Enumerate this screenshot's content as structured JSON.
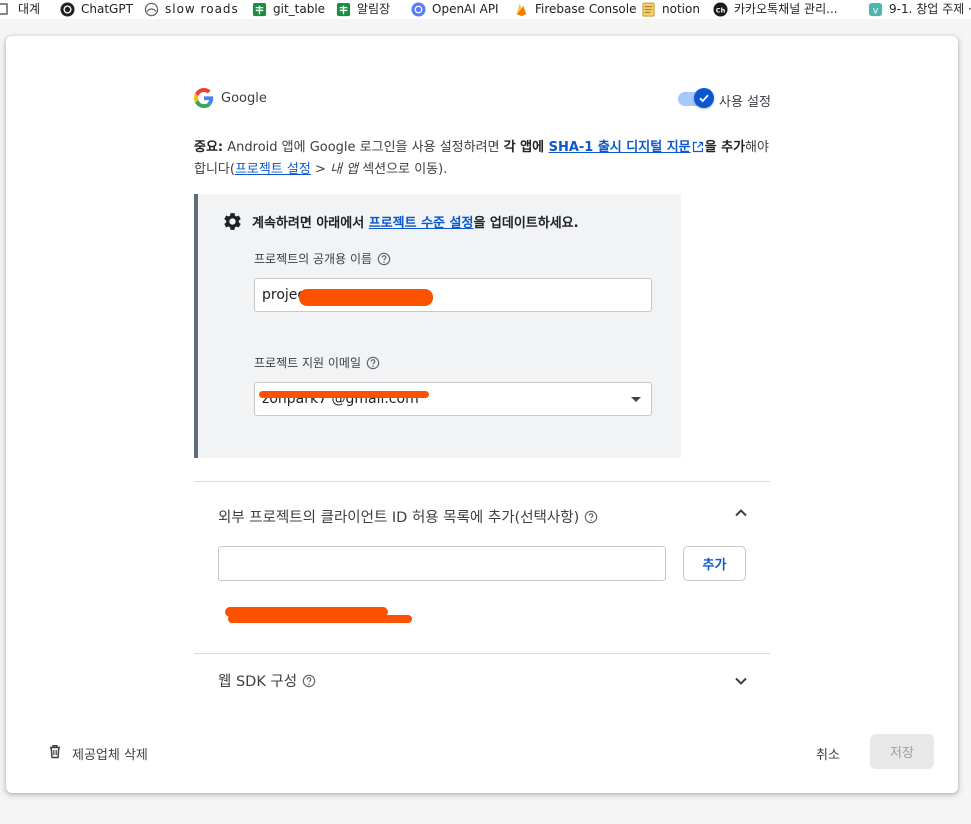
{
  "bookmarks": [
    {
      "label": "대계",
      "icon": "folder-icon"
    },
    {
      "label": "ChatGPT",
      "icon": "chatgpt-icon"
    },
    {
      "label": "slow roads",
      "icon": "slow-roads-icon"
    },
    {
      "label": "git_table",
      "icon": "sheets-icon"
    },
    {
      "label": "알림장",
      "icon": "sheets-icon"
    },
    {
      "label": "OpenAI API",
      "icon": "openai-icon"
    },
    {
      "label": "Firebase Console",
      "icon": "firebase-icon"
    },
    {
      "label": "notion",
      "icon": "notion-icon"
    },
    {
      "label": "카카오톡채널 관리...",
      "icon": "kakao-channel-icon"
    },
    {
      "label": "9-1. 창업 주제 ·",
      "icon": "v-app-icon"
    }
  ],
  "provider": {
    "name": "Google",
    "toggle_label": "사용 설정",
    "enabled": true
  },
  "notice": {
    "prefix": "중요:",
    "text1": " Android 앱에 Google 로그인을 사용 설정하려면 ",
    "bold1": "각 앱에 ",
    "link_sha": "SHA-1 출시 디지털 지문",
    "bold2": "을 추가",
    "text2": "해야 합니다(",
    "link_settings": "프로젝트 설정",
    "text3": " > ",
    "italic_myapps": "내 앱",
    "text4": " 섹션으로 이동)."
  },
  "setup": {
    "title_prefix": "계속하려면 아래에서 ",
    "title_link": "프로젝트 수준 설정",
    "title_suffix": "을 업데이트하세요.",
    "public_name_label": "프로젝트의 공개용 이름",
    "public_name_value": "projec",
    "support_email_label": "프로젝트 지원 이메일",
    "support_email_value": "zonpark7 @gmail.com"
  },
  "client_ids": {
    "title": "외부 프로젝트의 클라이언트 ID 허용 목록에 추가(선택사항)",
    "input_value": "",
    "add_label": "추가",
    "expanded": true
  },
  "web_sdk": {
    "title": "웹 SDK 구성",
    "expanded": false
  },
  "footer": {
    "delete_label": "제공업체 삭제",
    "cancel_label": "취소",
    "save_label": "저장"
  },
  "colors": {
    "link": "#0b57d0",
    "redaction": "#fc5200",
    "toggle_on": "#0b57d0"
  }
}
